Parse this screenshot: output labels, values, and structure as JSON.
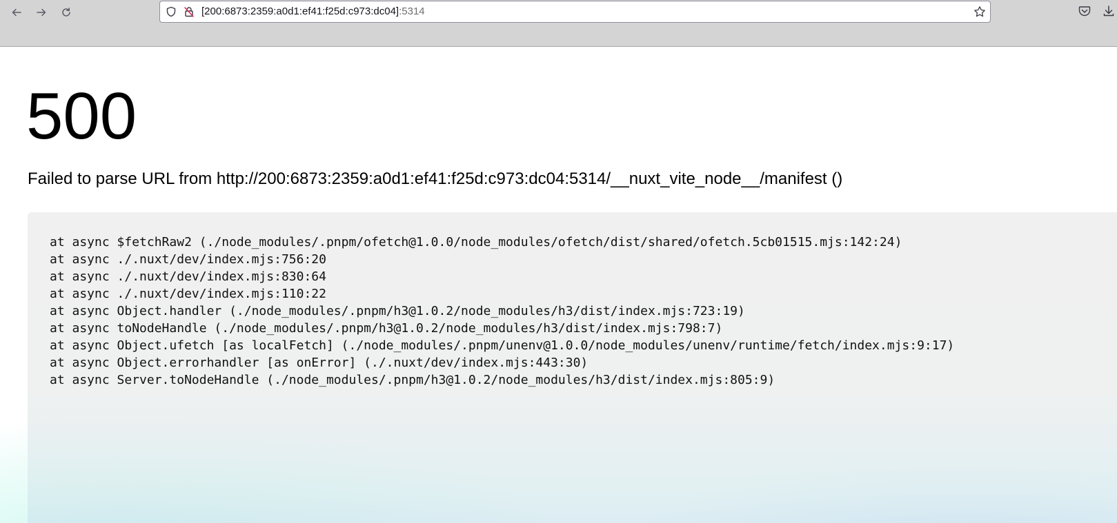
{
  "browser": {
    "url_host": "[200:6873:2359:a0d1:ef41:f25d:c973:dc04]",
    "url_port": ":5314",
    "nav": {
      "back_icon": "arrow-left-icon",
      "forward_icon": "arrow-right-icon",
      "reload_icon": "reload-icon"
    },
    "toolbar_icons": [
      "pocket-icon",
      "download-icon"
    ]
  },
  "error": {
    "status_code": "500",
    "message": "Failed to parse URL from http://200:6873:2359:a0d1:ef41:f25d:c973:dc04:5314/__nuxt_vite_node__/manifest ()",
    "stack": [
      "at async $fetchRaw2 (./node_modules/.pnpm/ofetch@1.0.0/node_modules/ofetch/dist/shared/ofetch.5cb01515.mjs:142:24)",
      "at async ./.nuxt/dev/index.mjs:756:20",
      "at async ./.nuxt/dev/index.mjs:830:64",
      "at async ./.nuxt/dev/index.mjs:110:22",
      "at async Object.handler (./node_modules/.pnpm/h3@1.0.2/node_modules/h3/dist/index.mjs:723:19)",
      "at async toNodeHandle (./node_modules/.pnpm/h3@1.0.2/node_modules/h3/dist/index.mjs:798:7)",
      "at async Object.ufetch [as localFetch] (./node_modules/.pnpm/unenv@1.0.0/node_modules/unenv/runtime/fetch/index.mjs:9:17)",
      "at async Object.errorhandler [as onError] (./.nuxt/dev/index.mjs:443:30)",
      "at async Server.toNodeHandle (./node_modules/.pnpm/h3@1.0.2/node_modules/h3/dist/index.mjs:805:9)"
    ]
  }
}
